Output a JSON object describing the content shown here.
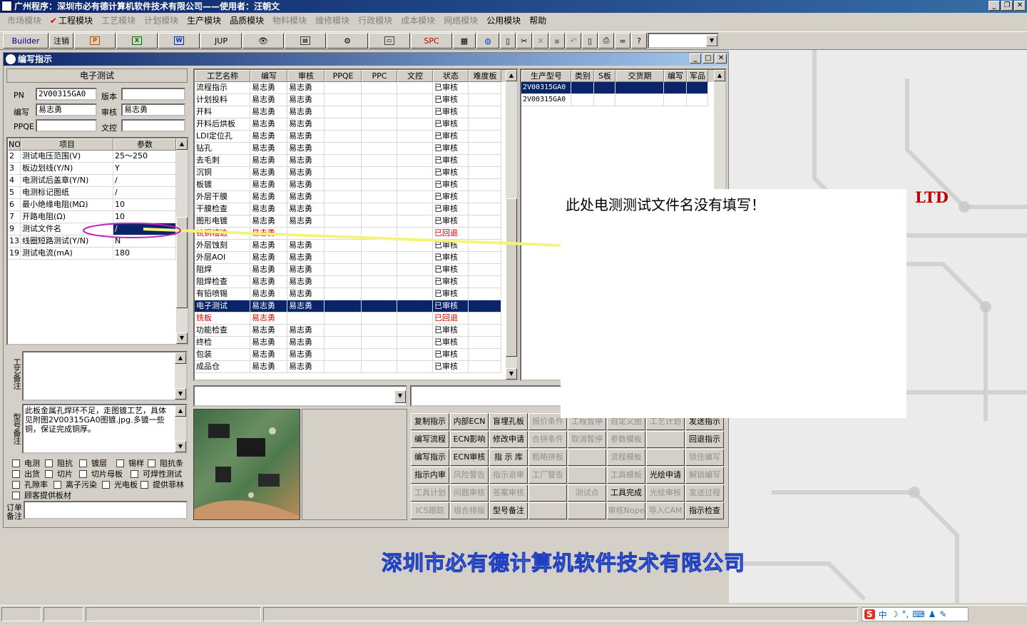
{
  "app": {
    "title": "广州程序：深圳市必有德计算机软件技术有限公司——使用者：汪朝文"
  },
  "menu": [
    {
      "label": "市场模块",
      "dim": true,
      "checked": false
    },
    {
      "label": "工程模块",
      "dim": false,
      "checked": true
    },
    {
      "label": "工艺模块",
      "dim": true,
      "checked": false
    },
    {
      "label": "计划模块",
      "dim": true,
      "checked": false
    },
    {
      "label": "生产模块",
      "dim": false,
      "checked": false
    },
    {
      "label": "品质模块",
      "dim": false,
      "checked": false
    },
    {
      "label": "物料模块",
      "dim": true,
      "checked": false
    },
    {
      "label": "维修模块",
      "dim": true,
      "checked": false
    },
    {
      "label": "行政模块",
      "dim": true,
      "checked": false
    },
    {
      "label": "成本模块",
      "dim": true,
      "checked": false
    },
    {
      "label": "网络模块",
      "dim": true,
      "checked": false
    },
    {
      "label": "公用模块",
      "dim": false,
      "checked": false
    },
    {
      "label": "帮助",
      "dim": false,
      "checked": false
    }
  ],
  "toolbar": {
    "builder": "Builder",
    "logout": "注销",
    "jup": "JUP",
    "spc": "SPC"
  },
  "window": {
    "title": "编写指示"
  },
  "left": {
    "section_title": "电子测试",
    "pn_label": "PN",
    "pn": "2V00315GA0",
    "version_label": "版本",
    "version": "",
    "author_label": "编写",
    "author": "易志勇",
    "review_label": "审核",
    "reviewer": "易志勇",
    "ppqe_label": "PPQE",
    "ppqe": "",
    "doc_label": "文控",
    "doc": "",
    "param_headers": [
      "NO",
      "项目",
      "参数"
    ],
    "params": [
      {
        "no": "2",
        "item": "测试电压范围(V)",
        "value": "25～250"
      },
      {
        "no": "3",
        "item": "板边划线(Y/N)",
        "value": "Y"
      },
      {
        "no": "4",
        "item": "电测试后盖章(Y/N)",
        "value": "/"
      },
      {
        "no": "5",
        "item": "电测标记图纸",
        "value": "/"
      },
      {
        "no": "6",
        "item": "最小绝缘电阻(MΩ)",
        "value": "10"
      },
      {
        "no": "7",
        "item": "开路电阻(Ω)",
        "value": "10"
      },
      {
        "no": "9",
        "item": "测试文件名",
        "value": "/"
      },
      {
        "no": "13",
        "item": "线圈短路测试(Y/N)",
        "value": "N"
      },
      {
        "no": "19",
        "item": "测试电流(mA)",
        "value": "180"
      }
    ],
    "process_note_label": "工艺备注",
    "process_note": "",
    "model_note_label": "型号备注",
    "model_note": "此板金属孔焊环不足，走图镀工艺，具体见附图2V00315GA0图镀.jpg.多镀一些铜，保证完成铜厚。",
    "checkboxes": [
      "电测",
      "阻抗",
      "镀层",
      "锡样",
      "阻抗条",
      "出货",
      "切片",
      "切片母板",
      "可焊性测试",
      "孔隙率",
      "离子污染",
      "光电板",
      "提供菲林",
      "顾客提供板材"
    ],
    "order_note_label": "订单备注"
  },
  "process": {
    "headers": [
      "工艺名称",
      "编写",
      "审核",
      "PPQE",
      "PPC",
      "文控",
      "状态",
      "难度板"
    ],
    "rows": [
      {
        "name": "流程指示",
        "author": "易志勇",
        "reviewer": "易志勇",
        "status": "已审核",
        "state": "normal"
      },
      {
        "name": "计划投料",
        "author": "易志勇",
        "reviewer": "易志勇",
        "status": "已审核",
        "state": "normal"
      },
      {
        "name": "开料",
        "author": "易志勇",
        "reviewer": "易志勇",
        "status": "已审核",
        "state": "normal"
      },
      {
        "name": "开料后烘板",
        "author": "易志勇",
        "reviewer": "易志勇",
        "status": "已审核",
        "state": "normal"
      },
      {
        "name": "LDI定位孔",
        "author": "易志勇",
        "reviewer": "易志勇",
        "status": "已审核",
        "state": "normal"
      },
      {
        "name": "钻孔",
        "author": "易志勇",
        "reviewer": "易志勇",
        "status": "已审核",
        "state": "normal"
      },
      {
        "name": "去毛刺",
        "author": "易志勇",
        "reviewer": "易志勇",
        "status": "已审核",
        "state": "normal"
      },
      {
        "name": "沉铜",
        "author": "易志勇",
        "reviewer": "易志勇",
        "status": "已审核",
        "state": "normal"
      },
      {
        "name": "板镀",
        "author": "易志勇",
        "reviewer": "易志勇",
        "status": "已审核",
        "state": "normal"
      },
      {
        "name": "外层干膜",
        "author": "易志勇",
        "reviewer": "易志勇",
        "status": "已审核",
        "state": "normal"
      },
      {
        "name": "干膜检查",
        "author": "易志勇",
        "reviewer": "易志勇",
        "status": "已审核",
        "state": "normal"
      },
      {
        "name": "图形电镀",
        "author": "易志勇",
        "reviewer": "易志勇",
        "status": "已审核",
        "state": "normal"
      },
      {
        "name": "铣铜槽边",
        "author": "易志勇",
        "reviewer": "",
        "status": "已回退",
        "state": "red"
      },
      {
        "name": "外层蚀刻",
        "author": "易志勇",
        "reviewer": "易志勇",
        "status": "已审核",
        "state": "normal"
      },
      {
        "name": "外层AOI",
        "author": "易志勇",
        "reviewer": "易志勇",
        "status": "已审核",
        "state": "normal"
      },
      {
        "name": "阻焊",
        "author": "易志勇",
        "reviewer": "易志勇",
        "status": "已审核",
        "state": "normal"
      },
      {
        "name": "阻焊检查",
        "author": "易志勇",
        "reviewer": "易志勇",
        "status": "已审核",
        "state": "normal"
      },
      {
        "name": "有铅喷锡",
        "author": "易志勇",
        "reviewer": "易志勇",
        "status": "已审核",
        "state": "normal"
      },
      {
        "name": "电子测试",
        "author": "易志勇",
        "reviewer": "易志勇",
        "status": "已审核",
        "state": "sel"
      },
      {
        "name": "铣板",
        "author": "易志勇",
        "reviewer": "",
        "status": "已回退",
        "state": "red"
      },
      {
        "name": "功能检查",
        "author": "易志勇",
        "reviewer": "易志勇",
        "status": "已审核",
        "state": "normal"
      },
      {
        "name": "终检",
        "author": "易志勇",
        "reviewer": "易志勇",
        "status": "已审核",
        "state": "normal"
      },
      {
        "name": "包装",
        "author": "易志勇",
        "reviewer": "易志勇",
        "status": "已审核",
        "state": "normal"
      },
      {
        "name": "成品仓",
        "author": "易志勇",
        "reviewer": "易志勇",
        "status": "已审核",
        "state": "normal"
      }
    ]
  },
  "models": {
    "headers": [
      "生产型号",
      "类别",
      "S板",
      "交货期",
      "编写",
      "军品"
    ],
    "rows": [
      {
        "model": "2V00315GA0",
        "sel": true
      },
      {
        "model": "2V00315GA0",
        "sel": false
      }
    ]
  },
  "actions": [
    {
      "label": "复制指示",
      "dim": false
    },
    {
      "label": "内部ECN",
      "dim": false
    },
    {
      "label": "盲埋孔板",
      "dim": false
    },
    {
      "label": "报价条件",
      "dim": true
    },
    {
      "label": "工程暂停",
      "dim": true
    },
    {
      "label": "自定义图",
      "dim": true
    },
    {
      "label": "工艺计划",
      "dim": true
    },
    {
      "label": "发送指示",
      "dim": false
    },
    {
      "label": "编写流程",
      "dim": false
    },
    {
      "label": "ECN影响",
      "dim": false
    },
    {
      "label": "修改申请",
      "dim": false
    },
    {
      "label": "合拼条件",
      "dim": true
    },
    {
      "label": "取消暂停",
      "dim": true
    },
    {
      "label": "参数模板",
      "dim": true
    },
    {
      "label": "",
      "dim": true
    },
    {
      "label": "回退指示",
      "dim": false
    },
    {
      "label": "编写指示",
      "dim": false
    },
    {
      "label": "ECN审核",
      "dim": false
    },
    {
      "label": "指 示 库",
      "dim": false
    },
    {
      "label": "粗略拼板",
      "dim": true
    },
    {
      "label": "",
      "dim": true
    },
    {
      "label": "流程模板",
      "dim": true
    },
    {
      "label": "",
      "dim": true
    },
    {
      "label": "锁住编写",
      "dim": true
    },
    {
      "label": "指示内审",
      "dim": false
    },
    {
      "label": "风险警告",
      "dim": true
    },
    {
      "label": "指示退审",
      "dim": true
    },
    {
      "label": "工厂警告",
      "dim": true
    },
    {
      "label": "",
      "dim": true
    },
    {
      "label": "工具模板",
      "dim": true
    },
    {
      "label": "光绘申请",
      "dim": false
    },
    {
      "label": "解锁编写",
      "dim": true
    },
    {
      "label": "工具计划",
      "dim": true
    },
    {
      "label": "问题审核",
      "dim": true
    },
    {
      "label": "答案审核",
      "dim": true
    },
    {
      "label": "",
      "dim": true
    },
    {
      "label": "测试点",
      "dim": true
    },
    {
      "label": "工具完成",
      "dim": false
    },
    {
      "label": "光绘审核",
      "dim": true
    },
    {
      "label": "发送过程",
      "dim": true
    },
    {
      "label": "ICS跟踪",
      "dim": true
    },
    {
      "label": "组合排版",
      "dim": true
    },
    {
      "label": "型号备注",
      "dim": false
    },
    {
      "label": "",
      "dim": true
    },
    {
      "label": "",
      "dim": true
    },
    {
      "label": "审核Nope",
      "dim": true
    },
    {
      "label": "导入CAM",
      "dim": true
    },
    {
      "label": "指示检查",
      "dim": false
    }
  ],
  "desktop": {
    "company": "深圳市必有德计算机软件技术有限公司",
    "ltd": "LTD"
  },
  "popup": {
    "text": "此处电测测试文件名没有填写！"
  },
  "ime": {
    "label": "中"
  },
  "colors": {
    "title_bg": "#0a246a",
    "selection": "#0a246a",
    "rollback": "#e00000",
    "annotation": "#f0f060",
    "highlight_ellipse": "#c020c0"
  }
}
